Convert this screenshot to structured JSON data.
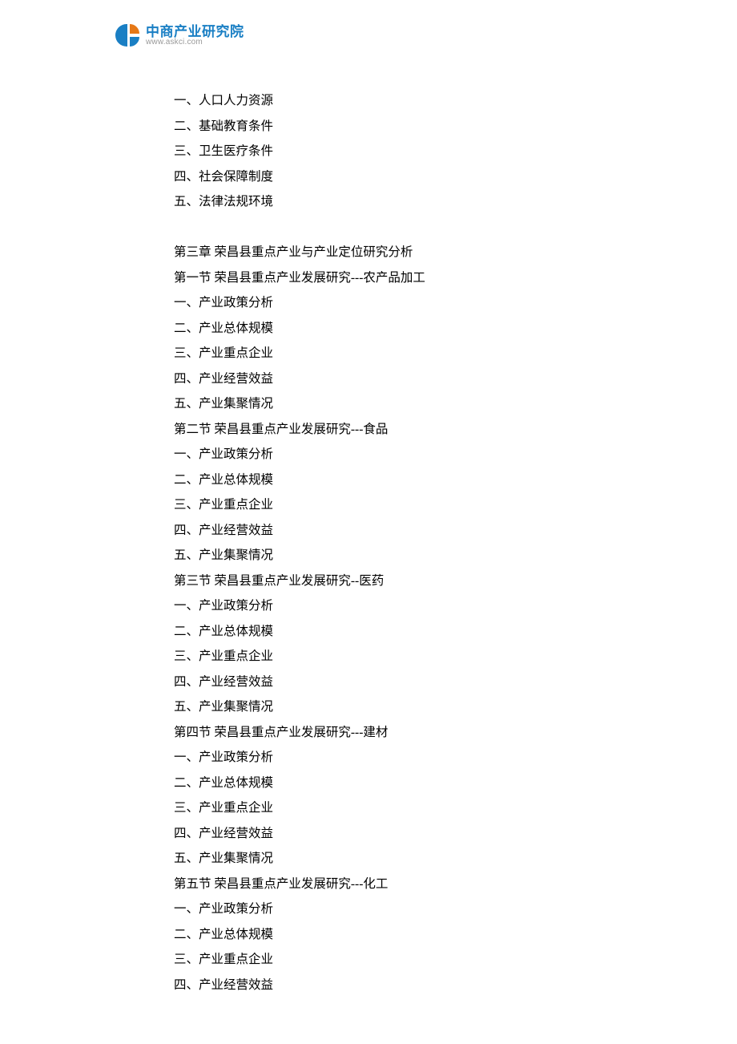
{
  "logo": {
    "title": "中商产业研究院",
    "url": "www.askci.com"
  },
  "lines": [
    "一、人口人力资源",
    "二、基础教育条件",
    "三、卫生医疗条件",
    "四、社会保障制度",
    "五、法律法规环境",
    "",
    "第三章  荣昌县重点产业与产业定位研究分析",
    "第一节  荣昌县重点产业发展研究---农产品加工",
    "一、产业政策分析",
    "二、产业总体规模",
    "三、产业重点企业",
    "四、产业经营效益",
    "五、产业集聚情况",
    "第二节  荣昌县重点产业发展研究---食品",
    "一、产业政策分析",
    "二、产业总体规模",
    "三、产业重点企业",
    "四、产业经营效益",
    "五、产业集聚情况",
    "第三节  荣昌县重点产业发展研究--医药",
    "一、产业政策分析",
    "二、产业总体规模",
    "三、产业重点企业",
    "四、产业经营效益",
    "五、产业集聚情况",
    "第四节  荣昌县重点产业发展研究---建材",
    "一、产业政策分析",
    "二、产业总体规模",
    "三、产业重点企业",
    "四、产业经营效益",
    "五、产业集聚情况",
    "第五节  荣昌县重点产业发展研究---化工",
    "一、产业政策分析",
    "二、产业总体规模",
    "三、产业重点企业",
    "四、产业经营效益"
  ]
}
